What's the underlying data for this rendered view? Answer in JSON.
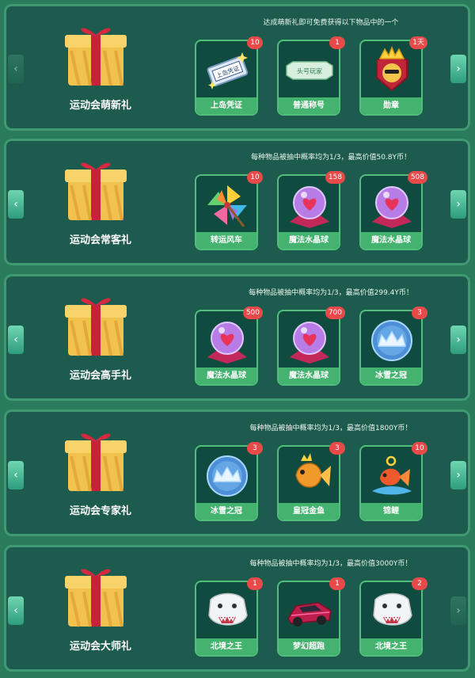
{
  "panels": [
    {
      "title": "运动会萌新礼",
      "desc": "达成萌新礼即可免费获得以下物品中的一个",
      "items": [
        {
          "name": "上岛凭证",
          "count": "10",
          "icon": "ticket-icon",
          "ticket_text": "上岛凭证"
        },
        {
          "name": "普通称号",
          "count": "1",
          "icon": "title-tag-icon",
          "tag_text": "头号玩家"
        },
        {
          "name": "勋章",
          "count": "1天",
          "icon": "crown-medal-icon"
        }
      ]
    },
    {
      "title": "运动会常客礼",
      "desc": "每种物品被抽中概率均为1/3，最高价值50.8Y币！",
      "items": [
        {
          "name": "转运风车",
          "count": "10",
          "icon": "pinwheel-icon"
        },
        {
          "name": "魔法水晶球",
          "count": "158",
          "icon": "crystal-ball-icon"
        },
        {
          "name": "魔法水晶球",
          "count": "508",
          "icon": "crystal-ball-icon"
        }
      ]
    },
    {
      "title": "运动会高手礼",
      "desc": "每种物品被抽中概率均为1/3，最高价值299.4Y币！",
      "items": [
        {
          "name": "魔法水晶球",
          "count": "500",
          "icon": "crystal-ball-icon"
        },
        {
          "name": "魔法水晶球",
          "count": "700",
          "icon": "crystal-ball-icon"
        },
        {
          "name": "冰雪之冠",
          "count": "3",
          "icon": "ice-crown-icon"
        }
      ]
    },
    {
      "title": "运动会专家礼",
      "desc": "每种物品被抽中概率均为1/3，最高价值1800Y币！",
      "items": [
        {
          "name": "冰雪之冠",
          "count": "3",
          "icon": "ice-crown-icon"
        },
        {
          "name": "皇冠金鱼",
          "count": "3",
          "icon": "goldfish-icon"
        },
        {
          "name": "锦鲤",
          "count": "10",
          "icon": "koi-icon"
        }
      ]
    },
    {
      "title": "运动会大师礼",
      "desc": "每种物品被抽中概率均为1/3，最高价值3000Y币！",
      "items": [
        {
          "name": "北境之王",
          "count": "1",
          "icon": "polar-bear-icon"
        },
        {
          "name": "梦幻超跑",
          "count": "1",
          "icon": "race-car-icon"
        },
        {
          "name": "北境之王",
          "count": "2",
          "icon": "polar-bear-icon"
        }
      ]
    }
  ],
  "colors": {
    "page_bg": "#2a7a5c",
    "panel_bg": "#1d5b4e",
    "card_label": "#44b36f",
    "badge": "#e84a4a"
  }
}
